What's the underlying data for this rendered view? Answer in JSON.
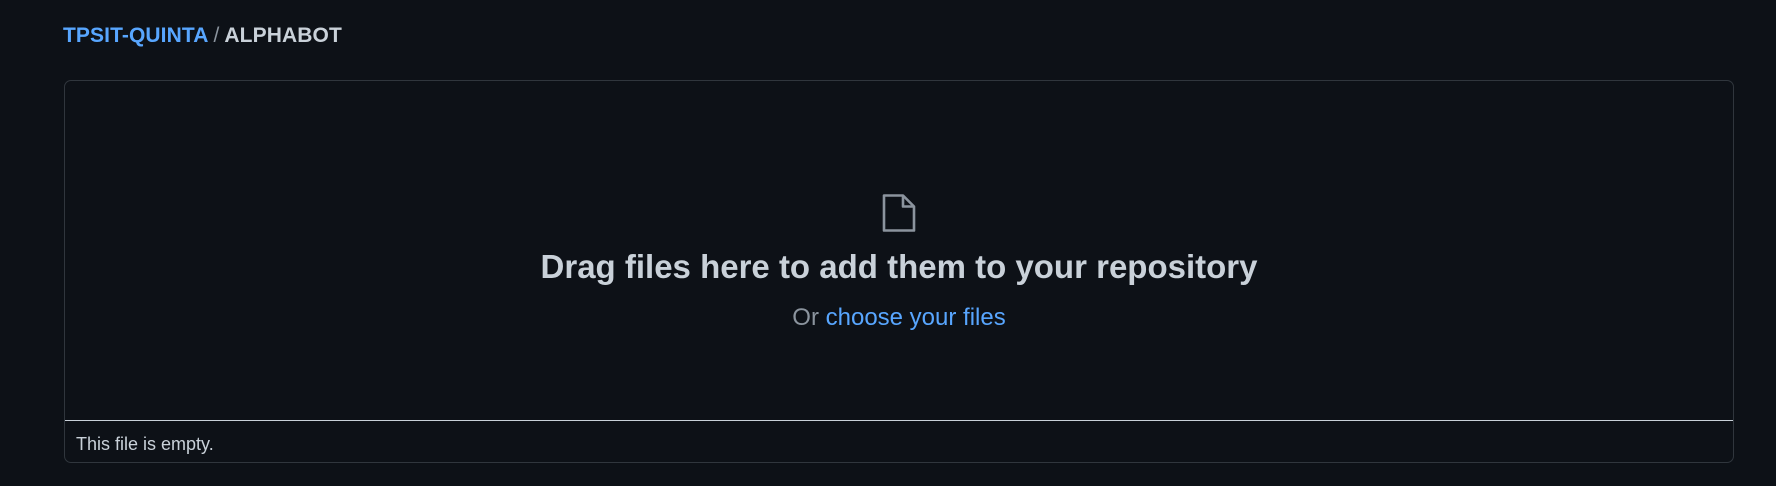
{
  "breadcrumb": {
    "owner": "TPSIT-QUINTA",
    "separator": "/",
    "repo": "ALPHABOT"
  },
  "dropzone": {
    "icon": "file-icon",
    "title": "Drag files here to add them to your repository",
    "or_text": "Or",
    "choose_link": "choose your files"
  },
  "footer": {
    "note": "This file is empty."
  },
  "colors": {
    "background": "#0d1117",
    "link": "#58a6ff",
    "text": "#c9d1d9",
    "muted": "#8b949e",
    "border": "#30363d"
  }
}
